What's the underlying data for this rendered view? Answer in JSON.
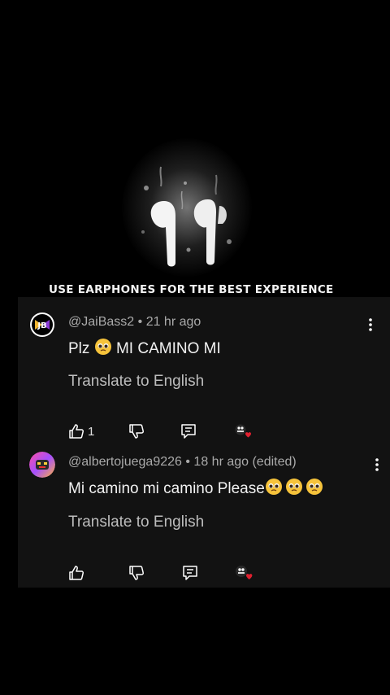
{
  "hero": {
    "caption": "USE EARPHONES FOR THE BEST EXPERIENCE"
  },
  "comments": [
    {
      "author": "@JaiBass2",
      "separator": "•",
      "time": "21 hr ago",
      "text_before": "Plz",
      "text_after": "MI CAMINO MI",
      "emoji_names": [
        "pleading-face"
      ],
      "translate": "Translate to English",
      "likes": "1",
      "avatar_icon": "jaibass-logo-icon",
      "creator_heart_icon": "creator-heart-icon"
    },
    {
      "author": "@albertojuega9226",
      "separator": "•",
      "time": "18 hr ago (edited)",
      "text_before": "Mi camino mi camino Please",
      "text_after": "",
      "emoji_names": [
        "pleading-face",
        "pleading-face",
        "pleading-face"
      ],
      "translate": "Translate to English",
      "likes": "",
      "avatar_icon": "albertojuega-avatar-icon",
      "creator_heart_icon": "creator-heart-icon"
    }
  ],
  "colors": {
    "panel_bg": "#121212",
    "meta_text": "#aaaaaa",
    "heart": "#e0202f",
    "emoji_yellow": "#f6c33b"
  }
}
